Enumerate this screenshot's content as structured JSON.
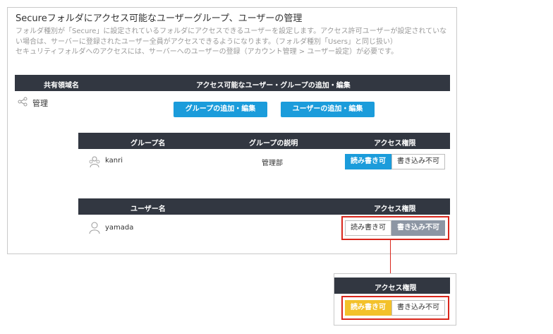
{
  "page": {
    "title": "Secureフォルダにアクセス可能なユーザーグループ、ユーザーの管理",
    "description_lines": [
      "フォルダ種別が「Secure」に設定されているフォルダにアクセスできるユーザーを設定します。アクセス許可ユーザーが設定されていな",
      "い場合は、サーバーに登録されたユーザー全員がアクセスできるようになります。（フォルダ種別「Users」と同じ扱い）",
      "セキュリティフォルダへのアクセスには、サーバーへのユーザーの登録（アカウント管理 > ユーザー設定）が必要です。"
    ]
  },
  "share_header": {
    "col_name": "共有領域名",
    "col_edit": "アクセス可能なユーザー・グループの追加・編集"
  },
  "share_row": {
    "icon": "share-icon",
    "name": "管理",
    "add_group_btn": "グループの追加・編集",
    "add_user_btn": "ユーザーの追加・編集"
  },
  "group_table": {
    "headers": [
      "グループ名",
      "グループの説明",
      "アクセス権限"
    ],
    "rows": [
      {
        "icon": "group-icon",
        "name": "kanri",
        "description": "管理部",
        "read_write": "読み書き可",
        "no_write": "書き込み不可",
        "selected": "read_write"
      }
    ]
  },
  "user_table": {
    "headers": [
      "ユーザー名",
      "アクセス権限"
    ],
    "rows": [
      {
        "icon": "user-icon",
        "name": "yamada",
        "read_write": "読み書き可",
        "no_write": "書き込み不可",
        "selected": "no_write"
      }
    ]
  },
  "detail_panel": {
    "header": "アクセス権限",
    "read_write": "読み書き可",
    "no_write": "書き込み不可",
    "selected": "read_write"
  },
  "colors": {
    "dark_header": "#323741",
    "accent_blue": "#1b9cdb",
    "selected_gray": "#8d96a4",
    "highlight_yellow": "#f3c12a",
    "callout_red": "#d9261c"
  }
}
